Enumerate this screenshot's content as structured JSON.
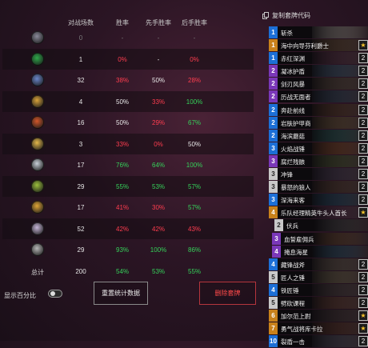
{
  "stats": {
    "headers": {
      "games": "对战场数",
      "winrate": "胜率",
      "first": "先手胜率",
      "second": "后手胜率"
    },
    "rows": [
      {
        "icon": "neutral-class-icon",
        "color": "#8a8a9a",
        "games": "0",
        "winrate": "-",
        "first": "-",
        "second": "-",
        "wr_tone": "grey",
        "first_tone": "grey",
        "second_tone": "grey"
      },
      {
        "icon": "hunter-class-icon",
        "color": "#2fa84a",
        "games": "1",
        "winrate": "0%",
        "first": "-",
        "second": "0%",
        "wr_tone": "red",
        "first_tone": "white",
        "second_tone": "red"
      },
      {
        "icon": "mage-class-icon",
        "color": "#6a86c9",
        "games": "32",
        "winrate": "38%",
        "first": "50%",
        "second": "28%",
        "wr_tone": "red",
        "first_tone": "white",
        "second_tone": "red"
      },
      {
        "icon": "rogue-class-icon",
        "color": "#d8a23a",
        "games": "4",
        "winrate": "50%",
        "first": "33%",
        "second": "100%",
        "wr_tone": "white",
        "first_tone": "red",
        "second_tone": "green"
      },
      {
        "icon": "warrior-class-icon",
        "color": "#d3572a",
        "games": "16",
        "winrate": "50%",
        "first": "29%",
        "second": "67%",
        "wr_tone": "white",
        "first_tone": "red",
        "second_tone": "green"
      },
      {
        "icon": "paladin-class-icon",
        "color": "#e3b84a",
        "games": "3",
        "winrate": "33%",
        "first": "0%",
        "second": "50%",
        "wr_tone": "red",
        "first_tone": "red",
        "second_tone": "white"
      },
      {
        "icon": "priest-class-icon",
        "color": "#c8cfd8",
        "games": "17",
        "winrate": "76%",
        "first": "64%",
        "second": "100%",
        "wr_tone": "green",
        "first_tone": "green",
        "second_tone": "green"
      },
      {
        "icon": "druid-class-icon",
        "color": "#9bbf3c",
        "games": "29",
        "winrate": "55%",
        "first": "53%",
        "second": "57%",
        "wr_tone": "green",
        "first_tone": "green",
        "second_tone": "green"
      },
      {
        "icon": "shaman-class-icon",
        "color": "#e0a536",
        "games": "17",
        "winrate": "41%",
        "first": "30%",
        "second": "57%",
        "wr_tone": "red",
        "first_tone": "red",
        "second_tone": "green"
      },
      {
        "icon": "warlock-class-icon",
        "color": "#c7b6d8",
        "games": "52",
        "winrate": "42%",
        "first": "42%",
        "second": "43%",
        "wr_tone": "red",
        "first_tone": "red",
        "second_tone": "red"
      },
      {
        "icon": "demonhunter-class-icon",
        "color": "#b7b7b7",
        "games": "29",
        "winrate": "93%",
        "first": "100%",
        "second": "86%",
        "wr_tone": "green",
        "first_tone": "green",
        "second_tone": "green"
      }
    ],
    "total": {
      "label": "总计",
      "games": "200",
      "winrate": "54%",
      "first": "53%",
      "second": "55%"
    }
  },
  "controls": {
    "show_percent_label": "显示百分比",
    "reset_button": "重置统计数据",
    "delete_button": "删除套牌"
  },
  "deck": {
    "copy_label": "复制套牌代码",
    "cards": [
      {
        "cost": "1",
        "name": "斩杀",
        "badge": "",
        "cost_color": "#1c6fd6",
        "art": "#b9b0a6"
      },
      {
        "cost": "1",
        "name": "海中向导芬利爵士",
        "badge": "★",
        "cost_color": "#c8811b",
        "art": "#7a5a3a"
      },
      {
        "cost": "1",
        "name": "赤红深渊",
        "badge": "2",
        "cost_color": "#1c6fd6",
        "art": "#6b3a52"
      },
      {
        "cost": "2",
        "name": "凝冰护盾",
        "badge": "2",
        "cost_color": "#7a37b8",
        "art": "#4d6b8a"
      },
      {
        "cost": "2",
        "name": "剑刃风暴",
        "badge": "2",
        "cost_color": "#7a37b8",
        "art": "#6d5a49"
      },
      {
        "cost": "2",
        "name": "历战无面者",
        "badge": "2",
        "cost_color": "#7a37b8",
        "art": "#3f5570"
      },
      {
        "cost": "2",
        "name": "奔赴前线",
        "badge": "2",
        "cost_color": "#1c6fd6",
        "art": "#70452f"
      },
      {
        "cost": "2",
        "name": "岩肤护甲商",
        "badge": "2",
        "cost_color": "#1c6fd6",
        "art": "#8a6a45"
      },
      {
        "cost": "2",
        "name": "海滨蘑菇",
        "badge": "2",
        "cost_color": "#1c6fd6",
        "art": "#2f6f6a"
      },
      {
        "cost": "3",
        "name": "火焰战锤",
        "badge": "2",
        "cost_color": "#1c6fd6",
        "art": "#a0552d"
      },
      {
        "cost": "3",
        "name": "腐烂残骸",
        "badge": "2",
        "cost_color": "#7a37b8",
        "art": "#5d6a3a"
      },
      {
        "cost": "3",
        "name": "冲锋",
        "badge": "2",
        "cost_color": "#c8c8c8",
        "art": "#5a4a66"
      },
      {
        "cost": "3",
        "name": "暴怒的狼人",
        "badge": "2",
        "cost_color": "#c8c8c8",
        "art": "#6a4a3a"
      },
      {
        "cost": "3",
        "name": "深海来客",
        "badge": "2",
        "cost_color": "#1c6fd6",
        "art": "#2d5a7a"
      },
      {
        "cost": "4",
        "name": "乐队经理精英牛头人酋长",
        "badge": "★",
        "cost_color": "#c8811b",
        "art": "#6a3a5a"
      },
      {
        "cost": "2",
        "name": "伏兵",
        "badge": "",
        "cost_color": "#c8c8c8",
        "art": "#5a5a5a",
        "indent": "1"
      },
      {
        "cost": "3",
        "name": "血誓雇佣兵",
        "badge": "",
        "cost_color": "#7a37b8",
        "art": "#8a5a3a",
        "indent": "2"
      },
      {
        "cost": "4",
        "name": "掩息海星",
        "badge": "",
        "cost_color": "#7a37b8",
        "art": "#3a6a8a",
        "indent": "2"
      },
      {
        "cost": "4",
        "name": "藏锋战斧",
        "badge": "2",
        "cost_color": "#1c6fd6",
        "art": "#7a6a5a"
      },
      {
        "cost": "5",
        "name": "匠人之锤",
        "badge": "2",
        "cost_color": "#c8c8c8",
        "art": "#8a7a5a"
      },
      {
        "cost": "4",
        "name": "铁匠锤",
        "badge": "2",
        "cost_color": "#1c6fd6",
        "art": "#5a4a4a"
      },
      {
        "cost": "5",
        "name": "劈砍课程",
        "badge": "2",
        "cost_color": "#c8c8c8",
        "art": "#7a4a3a"
      },
      {
        "cost": "6",
        "name": "加尔范上尉",
        "badge": "★",
        "cost_color": "#c8811b",
        "art": "#4a3a3a"
      },
      {
        "cost": "7",
        "name": "勇气战将库卡拉",
        "badge": "★",
        "cost_color": "#c8811b",
        "art": "#6a3a2a"
      },
      {
        "cost": "10",
        "name": "裂盾一击",
        "badge": "2",
        "cost_color": "#1c6fd6",
        "art": "#5a5a6a"
      }
    ]
  }
}
